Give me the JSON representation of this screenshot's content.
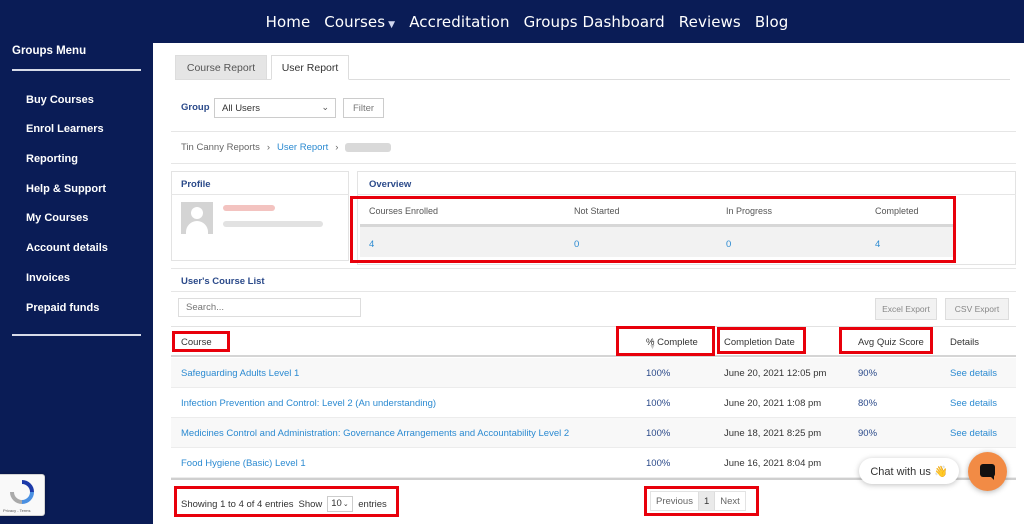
{
  "topnav": {
    "items": [
      {
        "label": "Home"
      },
      {
        "label": "Courses",
        "has_dropdown": true
      },
      {
        "label": "Accreditation"
      },
      {
        "label": "Groups Dashboard"
      },
      {
        "label": "Reviews"
      },
      {
        "label": "Blog"
      }
    ],
    "dropdown_icon": "chevron-down-icon"
  },
  "sidebar": {
    "title": "Groups Menu",
    "items": [
      {
        "label": "Buy Courses"
      },
      {
        "label": "Enrol Learners"
      },
      {
        "label": "Reporting"
      },
      {
        "label": "Help & Support"
      },
      {
        "label": "My Courses"
      },
      {
        "label": "Account details"
      },
      {
        "label": "Invoices"
      },
      {
        "label": "Prepaid funds"
      }
    ]
  },
  "recaptcha": {
    "text": "Privacy - Terms",
    "icon": "recaptcha-icon"
  },
  "tabs": [
    {
      "label": "Course Report",
      "active": false
    },
    {
      "label": "User Report",
      "active": true
    }
  ],
  "group_filter": {
    "label": "Group",
    "selected": "All Users",
    "button": "Filter"
  },
  "breadcrumb": {
    "root": "Tin Canny Reports",
    "current": "User Report"
  },
  "profile": {
    "title": "Profile"
  },
  "overview": {
    "title": "Overview",
    "labels": [
      "Courses Enrolled",
      "Not Started",
      "In Progress",
      "Completed"
    ],
    "values": [
      "4",
      "0",
      "0",
      "4"
    ]
  },
  "course_list": {
    "title": "User's Course List",
    "search_placeholder": "Search...",
    "excel_button": "Excel Export",
    "csv_button": "CSV Export",
    "headers": [
      "Course",
      "% Complete",
      "Completion Date",
      "Avg Quiz Score",
      "Details"
    ],
    "rows": [
      {
        "course": "Safeguarding Adults Level 1",
        "complete": "100%",
        "date": "June 20, 2021 12:05 pm",
        "quiz": "90%",
        "details": "See details"
      },
      {
        "course": "Infection Prevention and Control: Level 2 (An understanding)",
        "complete": "100%",
        "date": "June 20, 2021 1:08 pm",
        "quiz": "80%",
        "details": "See details"
      },
      {
        "course": "Medicines Control and Administration: Governance Arrangements and Accountability Level 2",
        "complete": "100%",
        "date": "June 18, 2021 8:25 pm",
        "quiz": "90%",
        "details": "See details"
      },
      {
        "course": "Food Hygiene (Basic) Level 1",
        "complete": "100%",
        "date": "June 16, 2021 8:04 pm",
        "quiz": "",
        "details": ""
      }
    ],
    "footer": {
      "showing": "Showing 1 to 4 of 4 entries",
      "show_label": "Show",
      "page_length": "10",
      "entries_label": "entries"
    },
    "pagination": {
      "previous": "Previous",
      "page": "1",
      "next": "Next"
    }
  },
  "chat": {
    "label": "Chat with us 👋",
    "icon": "chat-icon"
  },
  "colors": {
    "nav_bg": "#0a1c56",
    "link": "#2b8ad1",
    "highlight": "#e8000b",
    "chat": "#f28b45"
  }
}
